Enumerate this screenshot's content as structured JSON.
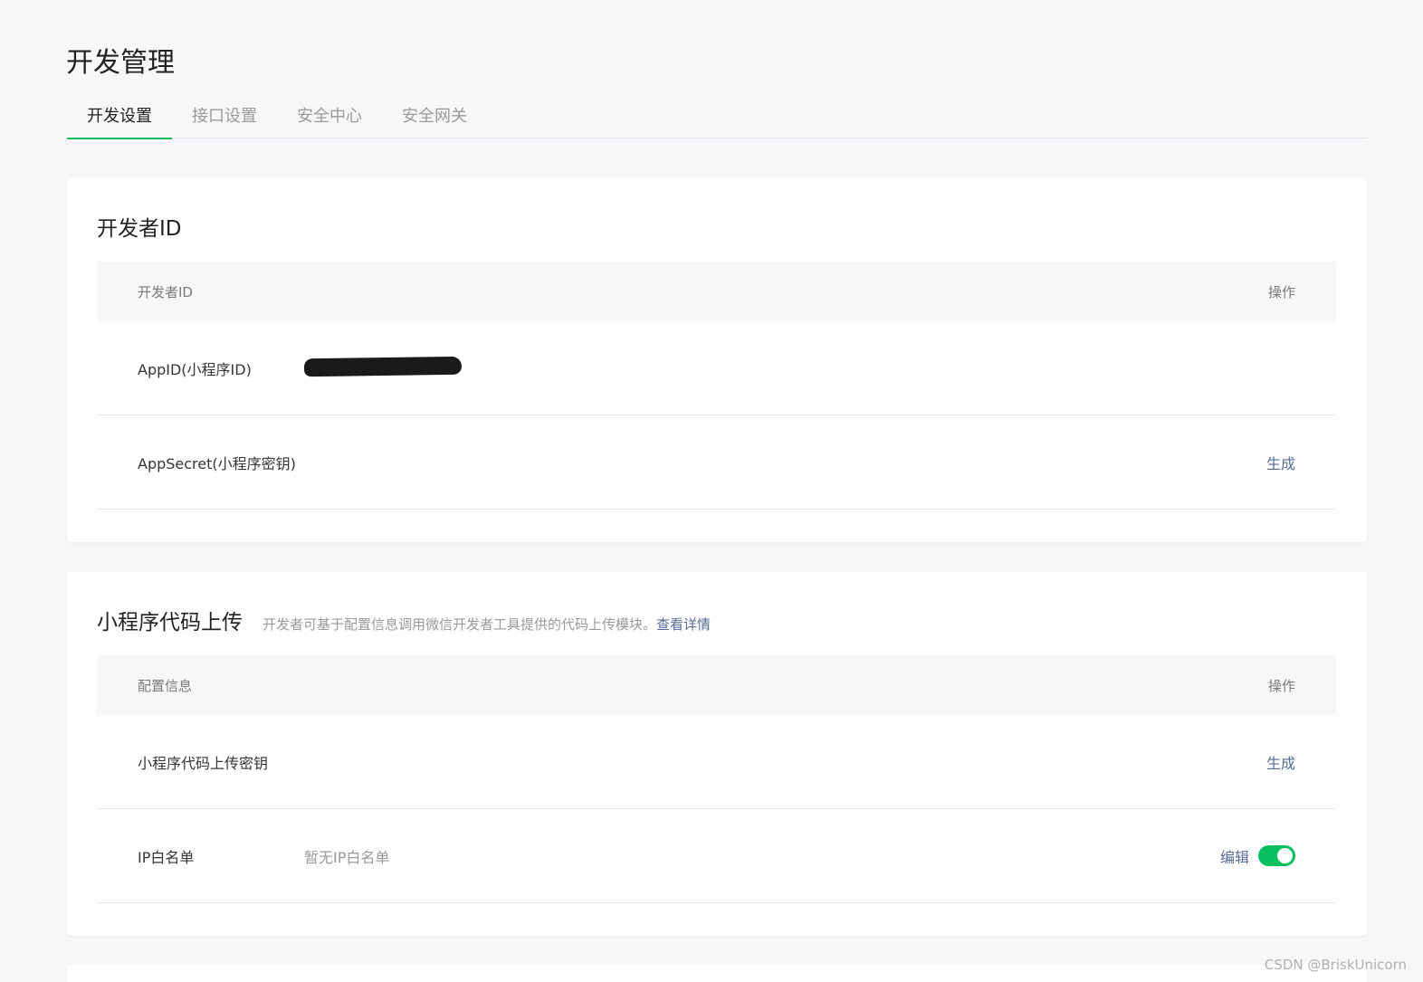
{
  "page": {
    "title": "开发管理"
  },
  "tabs": [
    {
      "label": "开发设置"
    },
    {
      "label": "接口设置"
    },
    {
      "label": "安全中心"
    },
    {
      "label": "安全网关"
    }
  ],
  "developer_id": {
    "title": "开发者ID",
    "header": {
      "col1": "开发者ID",
      "ops": "操作"
    },
    "rows": [
      {
        "label": "AppID(小程序ID)"
      },
      {
        "label": "AppSecret(小程序密钥)",
        "op": "生成"
      }
    ]
  },
  "code_upload": {
    "title": "小程序代码上传",
    "desc": "开发者可基于配置信息调用微信开发者工具提供的代码上传模块。",
    "desc_link": "查看详情",
    "header": {
      "col1": "配置信息",
      "ops": "操作"
    },
    "rows": [
      {
        "label": "小程序代码上传密钥",
        "op": "生成"
      },
      {
        "label": "IP白名单",
        "value": "暂无IP白名单",
        "op": "编辑",
        "toggle_on": true
      }
    ]
  },
  "colors": {
    "accent": "#07c160",
    "link": "#576b95"
  },
  "watermark": "CSDN @BriskUnicorn"
}
